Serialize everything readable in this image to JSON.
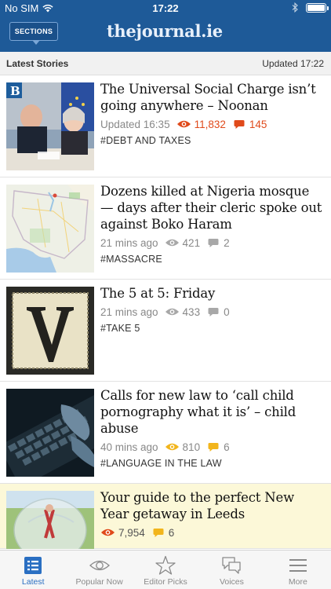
{
  "status_bar": {
    "carrier": "No SIM",
    "time": "17:22"
  },
  "header": {
    "sections_label": "SECTIONS",
    "logo": "thejournal.ie"
  },
  "subheader": {
    "title": "Latest Stories",
    "updated": "Updated 17:22"
  },
  "stories": [
    {
      "headline": "The Universal Social Charge isn’t going anywhere – Noonan",
      "timestamp": "Updated 16:35",
      "views": "11,832",
      "comments": "145",
      "tag": "#DEBT AND TAXES",
      "meta_style": "hot",
      "thumb": "press-conference-photo"
    },
    {
      "headline": "Dozens killed at Nigeria mosque — days after their cleric spoke out against Boko Haram",
      "timestamp": "21 mins ago",
      "views": "421",
      "comments": "2",
      "tag": "#MASSACRE",
      "meta_style": "normal",
      "thumb": "map-nigeria"
    },
    {
      "headline": "The 5 at 5: Friday",
      "timestamp": "21 mins ago",
      "views": "433",
      "comments": "0",
      "tag": "#TAKE 5",
      "meta_style": "normal",
      "thumb": "letter-v"
    },
    {
      "headline": "Calls for new law to ‘call child pornography what it is’ – child abuse",
      "timestamp": "40 mins ago",
      "views": "810",
      "comments": "6",
      "tag": "#LANGUAGE IN THE LAW",
      "meta_style": "warm",
      "thumb": "keyboard-hands"
    },
    {
      "headline": "Your guide to the perfect New Year getaway in Leeds",
      "timestamp": "",
      "views": "7,954",
      "comments": "6",
      "tag": "",
      "meta_style": "featured",
      "thumb": "zorb-ball"
    }
  ],
  "tabs": [
    {
      "label": "Latest",
      "icon": "list-icon",
      "active": true
    },
    {
      "label": "Popular Now",
      "icon": "eye-icon",
      "active": false
    },
    {
      "label": "Editor Picks",
      "icon": "star-icon",
      "active": false
    },
    {
      "label": "Voices",
      "icon": "chat-bubbles-icon",
      "active": false
    },
    {
      "label": "More",
      "icon": "hamburger-icon",
      "active": false
    }
  ],
  "colors": {
    "brand_blue": "#1e5a98",
    "active_tab": "#2a6fc2",
    "hot_red": "#e04a1b",
    "warm_yellow": "#f2b51c",
    "muted_gray": "#a8a8a8",
    "featured_bg": "#fcf8d8"
  }
}
